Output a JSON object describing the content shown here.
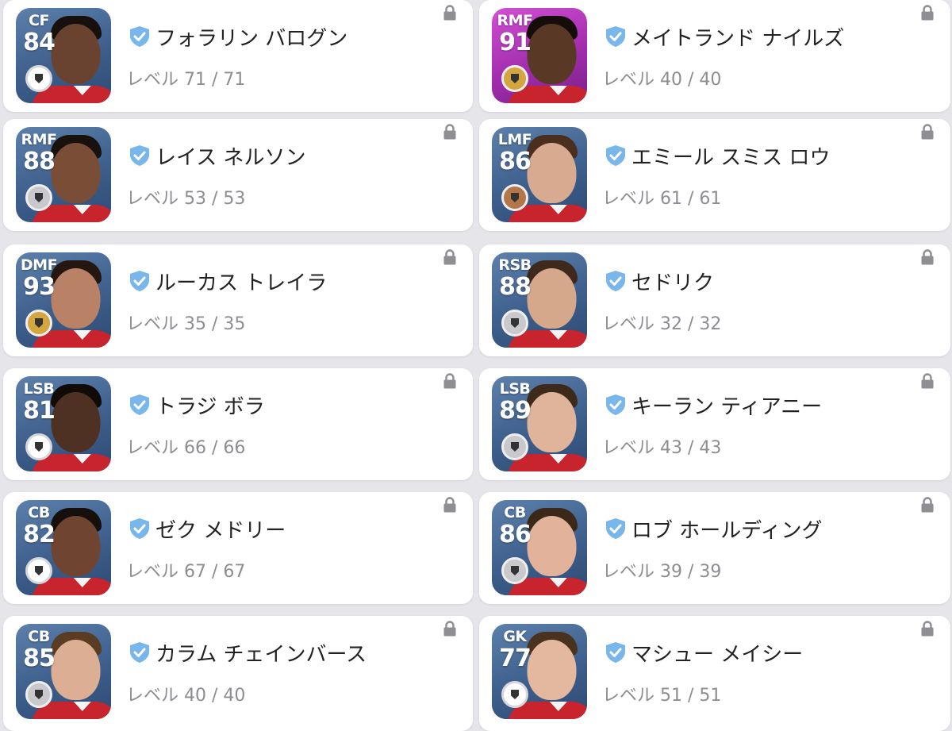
{
  "level_prefix": "レベル",
  "cards": [
    {
      "position": "CF",
      "rating": "84",
      "name": "フォラリン バログン",
      "level": "71 / 71",
      "medal": "white",
      "bg": "blue",
      "skin": "#6a4330",
      "hair": "#17100c"
    },
    {
      "position": "RMF",
      "rating": "91",
      "name": "メイトランド ナイルズ",
      "level": "40 / 40",
      "medal": "gold",
      "bg": "purple",
      "skin": "#5a3826",
      "hair": "#140d0a"
    },
    {
      "position": "RMF",
      "rating": "88",
      "name": "レイス ネルソン",
      "level": "53 / 53",
      "medal": "silver",
      "bg": "blue",
      "skin": "#7a4e36",
      "hair": "#18110d"
    },
    {
      "position": "LMF",
      "rating": "86",
      "name": "エミール スミス ロウ",
      "level": "61 / 61",
      "medal": "bronze",
      "bg": "blue",
      "skin": "#d8ab90",
      "hair": "#4a2e1e"
    },
    {
      "position": "DMF",
      "rating": "93",
      "name": "ルーカス トレイラ",
      "level": "35 / 35",
      "medal": "gold",
      "bg": "blue",
      "skin": "#b98266",
      "hair": "#24170f"
    },
    {
      "position": "RSB",
      "rating": "88",
      "name": "セドリク",
      "level": "32 / 32",
      "medal": "silver",
      "bg": "blue",
      "skin": "#d5a88c",
      "hair": "#3d2a1c"
    },
    {
      "position": "LSB",
      "rating": "81",
      "name": "トラジ ボラ",
      "level": "66 / 66",
      "medal": "white",
      "bg": "blue",
      "skin": "#4e3122",
      "hair": "#110b08"
    },
    {
      "position": "LSB",
      "rating": "89",
      "name": "キーラン ティアニー",
      "level": "43 / 43",
      "medal": "silver",
      "bg": "blue",
      "skin": "#e0b49a",
      "hair": "#3e2a1b"
    },
    {
      "position": "CB",
      "rating": "82",
      "name": "ゼク メドリー",
      "level": "67 / 67",
      "medal": "white",
      "bg": "blue",
      "skin": "#6f4531",
      "hair": "#16100c"
    },
    {
      "position": "CB",
      "rating": "86",
      "name": "ロブ ホールディング",
      "level": "39 / 39",
      "medal": "silver",
      "bg": "blue",
      "skin": "#e2b39a",
      "hair": "#3b2819"
    },
    {
      "position": "CB",
      "rating": "85",
      "name": "カラム チェインバース",
      "level": "40 / 40",
      "medal": "silver",
      "bg": "blue",
      "skin": "#dcae93",
      "hair": "#5a3b24"
    },
    {
      "position": "GK",
      "rating": "77",
      "name": "マシュー メイシー",
      "level": "51 / 51",
      "medal": "white",
      "bg": "blue",
      "skin": "#e4b89e",
      "hair": "#4a3220"
    }
  ],
  "colors": {
    "verified": "#79b6ea",
    "lock": "#8e8e93",
    "medal_white": "#ffffff",
    "medal_silver": "#c9c9cd",
    "medal_gold": "#d4a640",
    "medal_bronze": "#b5764a"
  }
}
